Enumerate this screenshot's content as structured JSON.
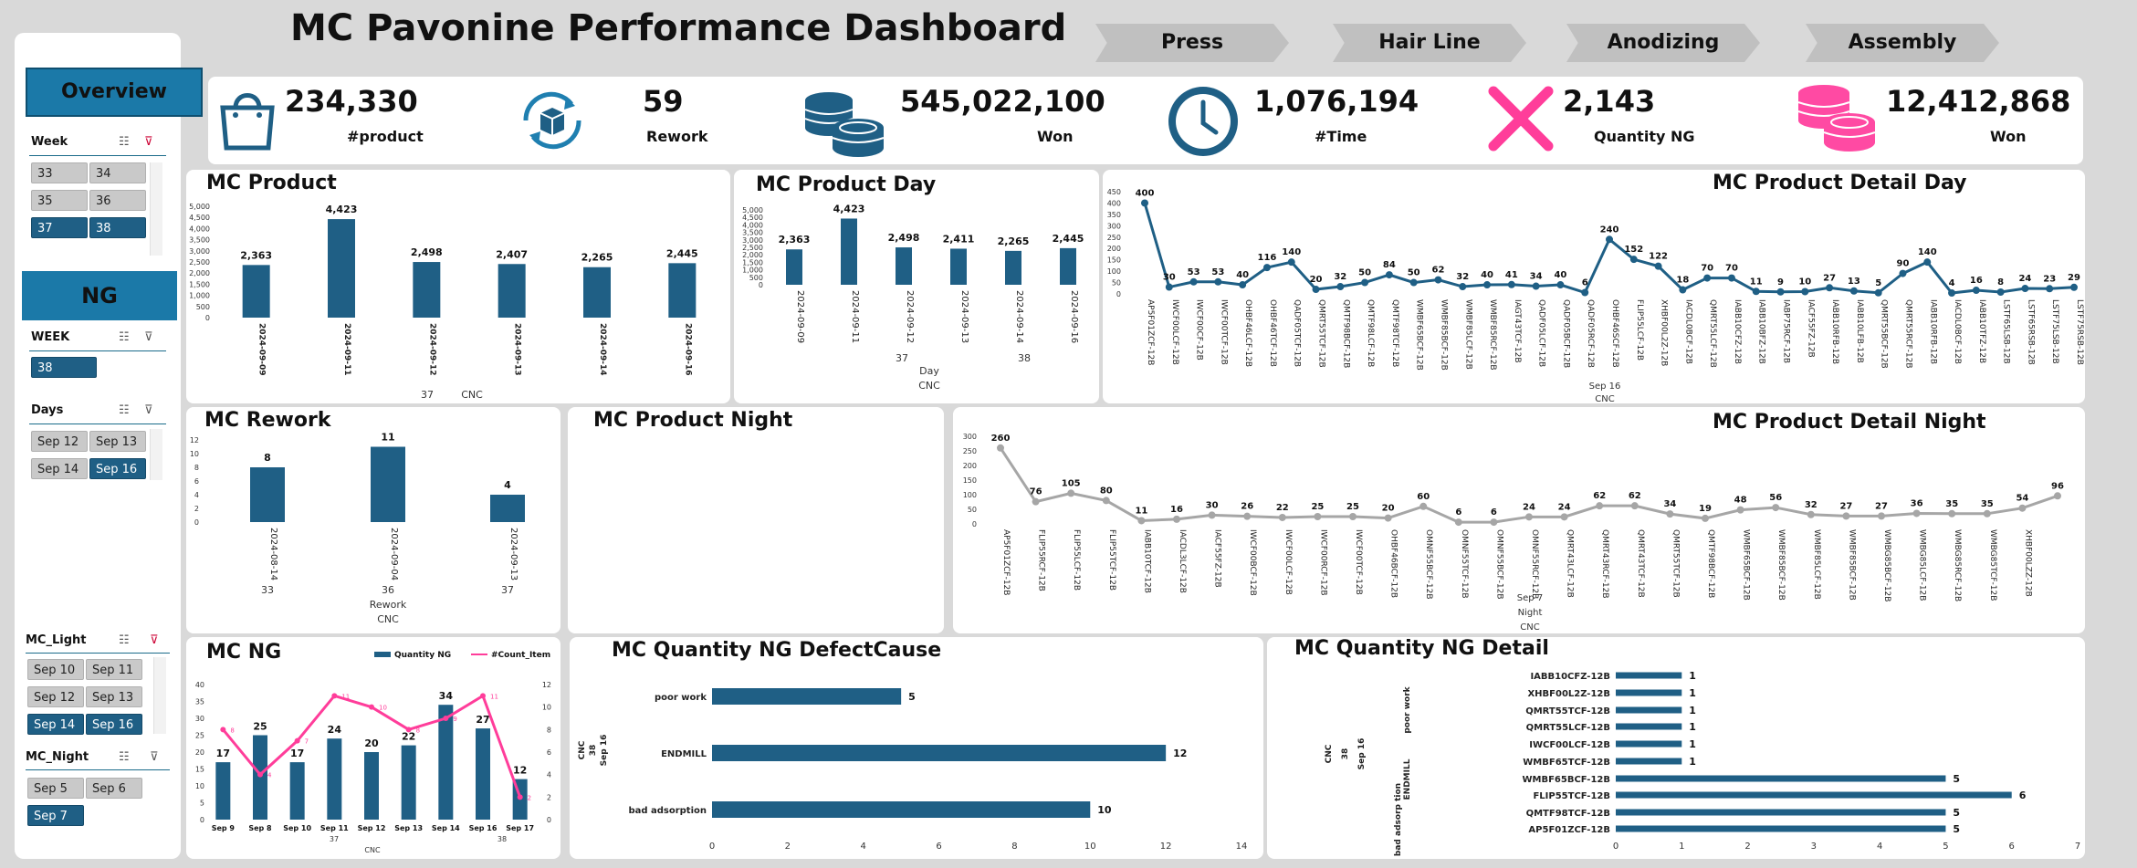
{
  "title": "MC Pavonine Performance Dashboard",
  "nav": [
    "Press",
    "Hair Line",
    "Anodizing",
    "Assembly"
  ],
  "sidebar": {
    "overview": "Overview",
    "week_title": "Week",
    "weeks": [
      {
        "label": "33",
        "on": false
      },
      {
        "label": "34",
        "on": false
      },
      {
        "label": "35",
        "on": false
      },
      {
        "label": "36",
        "on": false
      },
      {
        "label": "37",
        "on": true
      },
      {
        "label": "38",
        "on": true
      }
    ],
    "ng": "NG",
    "ng_week_title": "WEEK",
    "ng_weeks": [
      {
        "label": "38",
        "on": true
      }
    ],
    "days_title": "Days",
    "days": [
      {
        "label": "Sep 12",
        "on": false
      },
      {
        "label": "Sep 13",
        "on": false
      },
      {
        "label": "Sep 14",
        "on": false
      },
      {
        "label": "Sep 16",
        "on": true
      }
    ],
    "light_title": "MC_Light",
    "light": [
      {
        "label": "Sep 10",
        "on": false
      },
      {
        "label": "Sep 11",
        "on": false
      },
      {
        "label": "Sep 12",
        "on": false
      },
      {
        "label": "Sep 13",
        "on": false
      },
      {
        "label": "Sep 14",
        "on": true
      },
      {
        "label": "Sep 16",
        "on": true
      }
    ],
    "night_title": "MC_Night",
    "night": [
      {
        "label": "Sep 5",
        "on": false
      },
      {
        "label": "Sep 6",
        "on": false
      },
      {
        "label": "Sep 7",
        "on": true
      }
    ]
  },
  "kpis": [
    {
      "icon": "shopping-bag-icon",
      "value": "234,330",
      "label": "#product"
    },
    {
      "icon": "rework-box-icon",
      "value": "59",
      "label": "Rework"
    },
    {
      "icon": "coins-icon",
      "value": "545,022,100",
      "label": "Won"
    },
    {
      "icon": "clock-icon",
      "value": "1,076,194",
      "label": "#Time"
    },
    {
      "icon": "ng-x-icon",
      "value": "2,143",
      "label": "Quantity NG"
    },
    {
      "icon": "coins-pink-icon",
      "value": "12,412,868",
      "label": "Won"
    }
  ],
  "panels": {
    "mc_product": "MC Product",
    "mc_product_day": "MC Product Day",
    "mc_product_detail_day": "MC Product Detail Day",
    "mc_rework": "MC Rework",
    "mc_product_night": "MC Product Night",
    "mc_product_detail_night": "MC Product Detail Night",
    "mc_ng": "MC NG",
    "mc_qty_ng_defect": "MC Quantity NG DefectCause",
    "mc_qty_ng_detail": "MC Quantity NG Detail"
  },
  "colors": {
    "primary": "#1f5f85",
    "pink": "#ff3d9a",
    "gray": "#a6a6a6",
    "bg": "#d9d9d9"
  },
  "chart_data": [
    {
      "id": "mc_product",
      "type": "bar",
      "title": "MC Product",
      "categories": [
        "2024-09-09",
        "2024-09-11",
        "2024-09-12",
        "2024-09-13",
        "2024-09-14",
        "2024-09-16"
      ],
      "values": [
        2363,
        4423,
        2498,
        2407,
        2265,
        2445
      ],
      "value_labels": [
        "2,363",
        "4,423",
        "2,498",
        "2,407",
        "2,265",
        "2,445"
      ],
      "group_labels": [
        "37",
        "38"
      ],
      "xlabel": "CNC",
      "ylim": [
        0,
        5000
      ],
      "yticks": [
        "0",
        "500",
        "1,000",
        "1,500",
        "2,000",
        "2,500",
        "3,000",
        "3,500",
        "4,000",
        "4,500",
        "5,000"
      ]
    },
    {
      "id": "mc_product_day",
      "type": "bar",
      "title": "MC Product Day",
      "categories": [
        "2024-09-09",
        "2024-09-11",
        "2024-09-12",
        "2024-09-13",
        "2024-09-14",
        "2024-09-16"
      ],
      "values": [
        2363,
        4423,
        2498,
        2411,
        2265,
        2445
      ],
      "value_labels": [
        "2,363",
        "4,423",
        "2,498",
        "2,411",
        "2,265",
        "2,445"
      ],
      "group_labels": [
        "37",
        "38"
      ],
      "xlabel": "Day",
      "xlabel2": "CNC",
      "ylim": [
        0,
        5000
      ],
      "yticks": [
        "0",
        "500",
        "1,000",
        "1,500",
        "2,000",
        "2,500",
        "3,000",
        "3,500",
        "4,000",
        "4,500",
        "5,000"
      ]
    },
    {
      "id": "mc_product_detail_day",
      "type": "line",
      "title": "MC Product Detail Day",
      "categories": [
        "AP5F01ZCF-12B",
        "IWCF00LCF-12B",
        "IWCF00CF-12B",
        "IWCF00TCF-12B",
        "OHBF46LCF-12B",
        "OHBF46TCF-12B",
        "QADF05TCF-12B",
        "QMRT55TCF-12B",
        "QMTF98BCF-12B",
        "QMTF98LCF-12B",
        "QMTF98TCF-12B",
        "WMBF65BCF-12B",
        "WMBF85BCF-12B",
        "WMBF85LCF-12B",
        "WMBF85RCF-12B",
        "IAGT43TCF-12B",
        "QADF05LCF-12B",
        "QADF05BCF-12B",
        "QADF05RCF-12B",
        "OHBF46SCF-12B",
        "FLIP55LCF-12B",
        "XHBF00L2Z-12B",
        "IACDL0BCF-12B",
        "QMRT55LCF-12B",
        "IABB10CFZ-12B",
        "IABB10BFZ-12B",
        "IABP75RCF-12B",
        "IACF55FZ-12B",
        "IABB10RFB-12B",
        "IABB10LFB-12B",
        "QMRT55BCF-12B",
        "QMRT55RCF-12B",
        "IABB10RFB-12B",
        "IACDL0BCF-12B",
        "IABB10TFZ-12B",
        "LSTF65LSB-12B",
        "LSTF65RSB-12B",
        "LSTF75LSB-12B",
        "LSTF75RSB-12B"
      ],
      "values": [
        400,
        30,
        53,
        53,
        40,
        116,
        140,
        20,
        32,
        50,
        84,
        50,
        62,
        32,
        40,
        41,
        34,
        40,
        6,
        240,
        152,
        122,
        18,
        70,
        70,
        11,
        9,
        10,
        27,
        13,
        5,
        90,
        140,
        4,
        16,
        8,
        24,
        23,
        29
      ],
      "xlabel": "Sep 16",
      "xlabel2": "CNC",
      "ylim": [
        0,
        450
      ],
      "yticks": [
        "0",
        "50",
        "100",
        "150",
        "200",
        "250",
        "300",
        "350",
        "400",
        "450"
      ]
    },
    {
      "id": "mc_rework",
      "type": "bar",
      "title": "MC Rework",
      "categories": [
        "2024-08-14",
        "2024-09-04",
        "2024-09-13"
      ],
      "values": [
        8,
        11,
        4
      ],
      "value_labels": [
        "8",
        "11",
        "4"
      ],
      "group_labels": [
        "33",
        "36",
        "37"
      ],
      "xlabel": "Rework",
      "xlabel2": "CNC",
      "ylim": [
        0,
        12
      ],
      "yticks": [
        "0",
        "2",
        "4",
        "6",
        "8",
        "10",
        "12"
      ]
    },
    {
      "id": "mc_product_detail_night",
      "type": "line",
      "title": "MC Product Detail Night",
      "categories": [
        "AP5F01ZCF-12B",
        "FLIP55RCF-12B",
        "FLIP55LCF-12B",
        "FLIP55TCF-12B",
        "IABB10TCF-12B",
        "IACDL3LCF-12B",
        "IACF55FZ-12B",
        "IWCF00BCF-12B",
        "IWCF00LCF-12B",
        "IWCF00RCF-12B",
        "IWCF00TCF-12B",
        "OHBF46BCF-12B",
        "OMNF55BCF-12B",
        "OMNF55TCF-12B",
        "OMNF55BCF-12B",
        "OMNF55RCF-12B",
        "QMRT43LCF-12B",
        "QMRT43RCF-12B",
        "QMRT43TCF-12B",
        "QMRT55TCF-12B",
        "QMTF98BCF-12B",
        "WMBF65BCF-12B",
        "WMBF85BCF-12B",
        "WMBF85LCF-12B",
        "WMBF85BCF-12B",
        "WMBG85BCF-12B",
        "WMBG85LCF-12B",
        "WMBG85RCF-12B",
        "WMBG85TCF-12B",
        "XHBF00LZZ-12B"
      ],
      "values": [
        260,
        76,
        105,
        80,
        11,
        16,
        30,
        26,
        22,
        25,
        25,
        20,
        60,
        6,
        6,
        24,
        24,
        62,
        62,
        34,
        19,
        48,
        56,
        32,
        27,
        27,
        36,
        35,
        35,
        54,
        96
      ],
      "xlabel": "Sep 7",
      "xlabel2": "Night",
      "xlabel3": "CNC",
      "ylim": [
        0,
        300
      ],
      "yticks": [
        "0",
        "50",
        "100",
        "150",
        "200",
        "250",
        "300"
      ]
    },
    {
      "id": "mc_ng",
      "type": "bar+line",
      "title": "MC NG",
      "categories": [
        "Sep 9",
        "Sep 8",
        "Sep 10",
        "Sep 11",
        "Sep 12",
        "Sep 13",
        "Sep 14",
        "Sep 16",
        "Sep 17"
      ],
      "series": [
        {
          "name": "Quantity NG",
          "type": "bar",
          "values": [
            17,
            25,
            17,
            24,
            20,
            22,
            34,
            27,
            12
          ]
        },
        {
          "name": "#Count_Item",
          "type": "line",
          "values": [
            8,
            4,
            7,
            11,
            10,
            8,
            9,
            11,
            2
          ]
        }
      ],
      "group_labels": [
        "37",
        "38"
      ],
      "xlabel": "CNC",
      "ylim": [
        0,
        40
      ],
      "yticks": [
        "0",
        "5",
        "10",
        "15",
        "20",
        "25",
        "30",
        "35",
        "40"
      ],
      "y2lim": [
        0,
        12
      ],
      "y2ticks": [
        "0",
        "2",
        "4",
        "6",
        "8",
        "10",
        "12"
      ]
    },
    {
      "id": "mc_qty_ng_defect",
      "type": "bar",
      "orientation": "horizontal",
      "title": "MC Quantity NG DefectCause",
      "categories": [
        "poor work",
        "ENDMILL",
        "bad adsorption"
      ],
      "values": [
        5,
        12,
        10
      ],
      "row_labels": [
        "CNC",
        "38",
        "Sep 16"
      ],
      "xlim": [
        0,
        14
      ],
      "xticks": [
        "0",
        "2",
        "4",
        "6",
        "8",
        "10",
        "12",
        "14"
      ]
    },
    {
      "id": "mc_qty_ng_detail",
      "type": "bar",
      "orientation": "horizontal",
      "title": "MC Quantity NG Detail",
      "categories": [
        "IABB10CFZ-12B",
        "XHBF00L2Z-12B",
        "QMRT55TCF-12B",
        "QMRT55LCF-12B",
        "IWCF00LCF-12B",
        "WMBF65TCF-12B",
        "WMBF65BCF-12B",
        "FLIP55TCF-12B",
        "QMTF98TCF-12B",
        "AP5F01ZCF-12B"
      ],
      "values": [
        1,
        1,
        1,
        1,
        1,
        1,
        5,
        6,
        5,
        5
      ],
      "groups": [
        "poor work",
        "ENDMILL",
        "bad adsorp tion"
      ],
      "row_labels": [
        "CNC",
        "38",
        "Sep 16"
      ],
      "xlim": [
        0,
        7
      ],
      "xticks": [
        "0",
        "1",
        "2",
        "3",
        "4",
        "5",
        "6",
        "7"
      ]
    }
  ]
}
